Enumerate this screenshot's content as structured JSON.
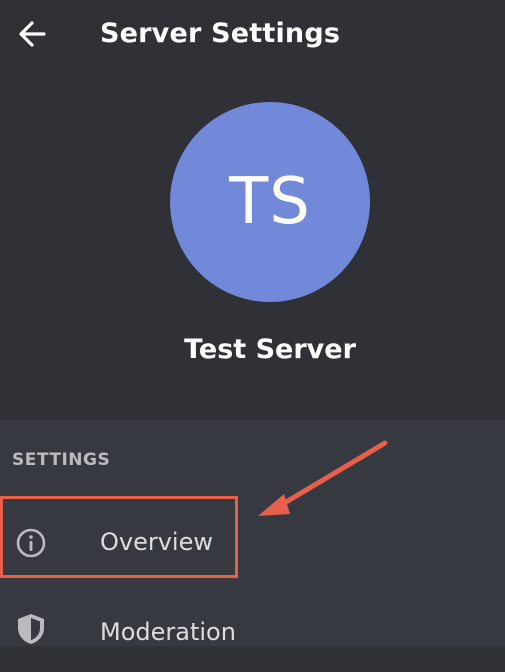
{
  "header": {
    "title": "Server Settings",
    "back_icon": "arrow-left-icon"
  },
  "server": {
    "initials": "TS",
    "name": "Test Server",
    "avatar_color": "#7289da"
  },
  "settings": {
    "section_label": "SETTINGS",
    "items": [
      {
        "label": "Overview",
        "icon": "info-circle-icon"
      },
      {
        "label": "Moderation",
        "icon": "shield-icon"
      }
    ]
  },
  "colors": {
    "background": "#2f3136",
    "settings_background": "#36393f",
    "annotation": "#e8604c"
  }
}
